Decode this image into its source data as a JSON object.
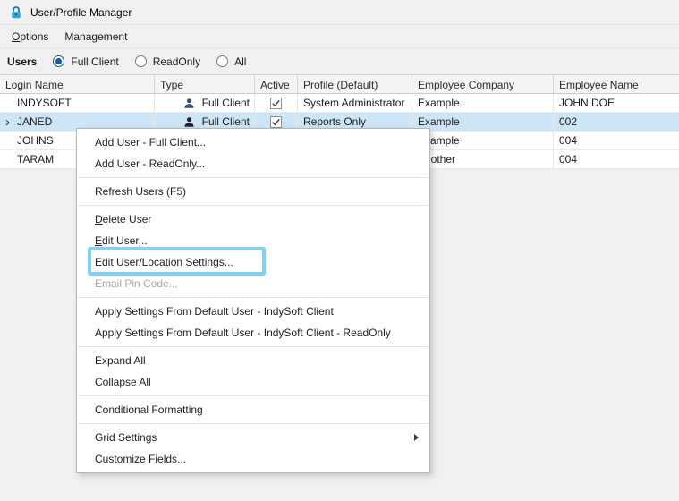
{
  "window": {
    "title": "User/Profile Manager"
  },
  "menubar": {
    "options": {
      "pre": "",
      "key": "O",
      "post": "ptions"
    },
    "management": {
      "pre": "Management",
      "key": "",
      "post": ""
    }
  },
  "users_filter": {
    "label": "Users",
    "options": [
      {
        "label": "Full Client",
        "selected": true
      },
      {
        "label": "ReadOnly",
        "selected": false
      },
      {
        "label": "All",
        "selected": false
      }
    ]
  },
  "grid": {
    "columns": [
      {
        "label": "Login Name"
      },
      {
        "label": "Type"
      },
      {
        "label": "Active"
      },
      {
        "label": "Profile (Default)"
      },
      {
        "label": "Employee Company"
      },
      {
        "label": "Employee Name"
      }
    ],
    "rows": [
      {
        "login": "INDYSOFT",
        "type": "Full Client",
        "active": true,
        "profile": "System Administrator",
        "company": "Example",
        "employee": "JOHN DOE",
        "selected": false,
        "icon_color": "#2d4f8e"
      },
      {
        "login": "JANED",
        "type": "Full Client",
        "active": true,
        "profile": "Reports Only",
        "company": "Example",
        "employee": "002",
        "selected": true,
        "icon_color": "#20202e"
      },
      {
        "login": "JOHNS",
        "type": "",
        "active": null,
        "profile": "",
        "company": "Example",
        "employee": "004",
        "selected": false
      },
      {
        "login": "TARAM",
        "type": "",
        "active": null,
        "profile": "",
        "company": "Another",
        "employee": "004",
        "selected": false
      }
    ],
    "selected_row_color": "#cde6f7"
  },
  "context_menu": {
    "items": [
      {
        "pre": "Add User - Full Client...",
        "key": "",
        "post": "",
        "disabled": false
      },
      {
        "pre": "Add User - ReadOnly...",
        "key": "",
        "post": "",
        "disabled": false
      },
      {
        "pre": "Refresh Users (F5)",
        "key": "",
        "post": "",
        "disabled": false
      },
      {
        "pre": "",
        "key": "D",
        "post": "elete User",
        "disabled": false
      },
      {
        "pre": "",
        "key": "E",
        "post": "dit User...",
        "disabled": false
      },
      {
        "pre": "Edit User/Location Settings...",
        "key": "",
        "post": "",
        "disabled": false
      },
      {
        "pre": "Email Pin Code...",
        "key": "",
        "post": "",
        "disabled": true
      },
      {
        "pre": "Apply Settings From Default User - IndySoft Client",
        "key": "",
        "post": "",
        "disabled": false
      },
      {
        "pre": "Apply Settings From Default User - IndySoft Client - ReadOnly",
        "key": "",
        "post": "",
        "disabled": false
      },
      {
        "pre": "Expand All",
        "key": "",
        "post": "",
        "disabled": false
      },
      {
        "pre": "Collapse All",
        "key": "",
        "post": "",
        "disabled": false
      },
      {
        "pre": "Conditional Formatting",
        "key": "",
        "post": "",
        "disabled": false
      },
      {
        "pre": "Grid Settings",
        "key": "",
        "post": "",
        "disabled": false,
        "has_submenu": true
      },
      {
        "pre": "Customize Fields...",
        "key": "",
        "post": "",
        "disabled": false
      }
    ]
  },
  "annotation": {
    "highlight_color": "#7ed2f3"
  }
}
